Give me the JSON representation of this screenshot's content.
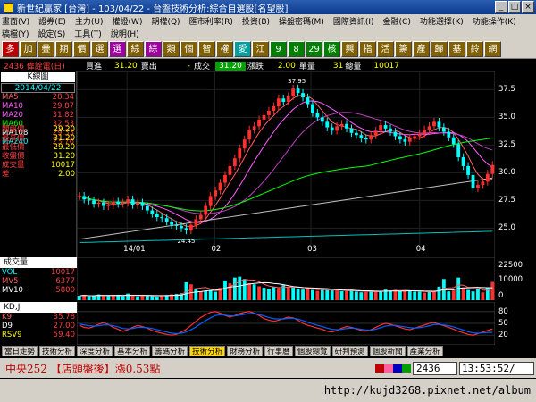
{
  "window": {
    "title": "新世紀贏家 [台灣] - 103/04/22 - 台盤技術分析:綜合自選股[名望股]",
    "buttons": [
      "_",
      "□",
      "×"
    ]
  },
  "menu": {
    "row1": [
      "畫面(V)",
      "證券(E)",
      "主力(U)",
      "權證(W)",
      "期權(Q)",
      "匯市利率(R)",
      "投資(B)",
      "操盤密碼(M)",
      "國際資訊(I)",
      "金融(C)",
      "功能選擇(K)",
      "功能操作(K)"
    ],
    "row2": [
      "稿檔(Y)",
      "設定(S)",
      "工具(T)",
      "說明(H)"
    ]
  },
  "toolbar": {
    "buttons": [
      {
        "label": "多",
        "color": "#c00000"
      },
      {
        "label": "加",
        "color": "#806000"
      },
      {
        "label": "疊",
        "color": "#806000"
      },
      {
        "label": "期",
        "color": "#806000"
      },
      {
        "label": "價",
        "color": "#806000"
      },
      {
        "label": "選",
        "color": "#806000"
      },
      {
        "label": "選",
        "color": "#a000a0"
      },
      {
        "label": "綜",
        "color": "#806000"
      },
      {
        "label": "綜",
        "color": "#a000a0"
      },
      {
        "label": "類",
        "color": "#806000"
      },
      {
        "label": "個",
        "color": "#806000"
      },
      {
        "label": "智",
        "color": "#806000"
      },
      {
        "label": "權",
        "color": "#806000"
      },
      {
        "label": "愛",
        "color": "#00a0a0"
      },
      {
        "label": "江",
        "color": "#806000"
      },
      {
        "label": "9",
        "color": "#008000"
      },
      {
        "label": "8",
        "color": "#008000"
      },
      {
        "label": "29",
        "color": "#008000"
      },
      {
        "label": "核",
        "color": "#008000"
      },
      {
        "label": "興",
        "color": "#806000"
      },
      {
        "label": "指",
        "color": "#806000"
      },
      {
        "label": "活",
        "color": "#806000"
      },
      {
        "label": "籌",
        "color": "#806000"
      },
      {
        "label": "產",
        "color": "#806000"
      },
      {
        "label": "歸",
        "color": "#806000"
      },
      {
        "label": "基",
        "color": "#806000"
      },
      {
        "label": "鈴",
        "color": "#806000"
      },
      {
        "label": "網",
        "color": "#806000"
      }
    ]
  },
  "quote": {
    "stock": "2436 偉詮電(日)",
    "buy_label": "買進",
    "buy_value": "31.20",
    "sell_label": "賣出",
    "sell_value": "-",
    "trade_label": "成交",
    "trade_value": "31.20",
    "change_label": "漲跌",
    "change_value": "2.00",
    "single_label": "單量",
    "single_value": "31",
    "total_label": "總量",
    "total_value": "10017"
  },
  "panel": {
    "header": "K線圖",
    "date": "2014/04/22",
    "ma": [
      {
        "label": "MA5",
        "value": "28.34",
        "color": "#ff6060"
      },
      {
        "label": "MA10",
        "value": "29.87",
        "color": "#ff60ff"
      },
      {
        "label": "MA20",
        "value": "31.82",
        "color": "#ff60ff"
      },
      {
        "label": "MA60",
        "value": "32.53",
        "color": "#00ff00"
      },
      {
        "label": "MA108",
        "value": "29.33",
        "color": "#ffffff"
      },
      {
        "label": "MA240",
        "value": "23.76",
        "color": "#00ffff"
      }
    ],
    "prices": [
      {
        "label": "開盤價",
        "value": "29.20"
      },
      {
        "label": "最高價",
        "value": "31.20"
      },
      {
        "label": "最低價",
        "value": "29.20"
      },
      {
        "label": "收盤價",
        "value": "31.20"
      },
      {
        "label": "成交量",
        "value": "10017"
      },
      {
        "label": "差",
        "value": "2.00"
      }
    ]
  },
  "volume": {
    "header": "成交量",
    "legend": [
      {
        "label": "VOL",
        "value": "10017",
        "color": "#00ffff"
      },
      {
        "label": "MV5",
        "value": "6377",
        "color": "#ff6060"
      },
      {
        "label": "MV10",
        "value": "5800",
        "color": "#ffffff"
      }
    ],
    "axis": [
      "22500",
      "10000",
      "0"
    ]
  },
  "kd": {
    "header": "KD,J",
    "legend": [
      {
        "label": "K9",
        "value": "35.78",
        "color": "#ff6060"
      },
      {
        "label": "D9",
        "value": "27.00",
        "color": "#ffffff"
      },
      {
        "label": "RSV9",
        "value": "59.40",
        "color": "#ffff00"
      }
    ],
    "axis": [
      "80",
      "50",
      "20"
    ]
  },
  "chart_data": [
    {
      "type": "candlestick",
      "title": "K線圖",
      "ylim": [
        23.5,
        38.5
      ],
      "y_ticks": [
        "37.5",
        "35.0",
        "32.5",
        "30.0",
        "27.5",
        "25.0"
      ],
      "x_ticks": [
        "14/01",
        "02",
        "03",
        "04"
      ],
      "annotations": [
        "37.95",
        "24.45"
      ],
      "close": [
        27.9,
        27.6,
        27.5,
        27.2,
        27.3,
        27.0,
        27.1,
        27.4,
        27.2,
        27.3,
        27.6,
        27.1,
        27.3,
        27.0,
        26.6,
        26.3,
        26.0,
        25.9,
        25.6,
        25.3,
        25.2,
        25.0,
        24.8,
        25.3,
        25.8,
        26.2,
        27.0,
        27.9,
        28.4,
        29.1,
        29.8,
        30.6,
        31.3,
        32.2,
        33.0,
        33.9,
        34.2,
        34.8,
        35.2,
        35.6,
        36.0,
        36.7,
        36.4,
        36.9,
        37.6,
        37.2,
        36.8,
        36.2,
        35.4,
        35.0,
        34.6,
        34.1,
        33.8,
        34.2,
        34.4,
        34.0,
        33.6,
        33.4,
        33.1,
        33.0,
        33.4,
        33.8,
        34.3,
        34.0,
        33.7,
        33.3,
        33.0,
        32.8,
        33.1,
        33.3,
        33.5,
        33.9,
        34.2,
        34.6,
        34.1,
        33.7,
        33.2,
        32.6,
        31.4,
        30.6,
        29.8,
        28.6,
        28.9,
        29.2,
        29.9,
        30.7
      ],
      "ma_lines": [
        {
          "name": "MA5",
          "color": "#ff6060"
        },
        {
          "name": "MA10",
          "color": "#ff60ff"
        },
        {
          "name": "MA20",
          "color": "#ff60ff"
        },
        {
          "name": "MA60",
          "color": "#00ff00"
        },
        {
          "name": "MA108",
          "color": "#ffffff"
        },
        {
          "name": "MA240",
          "color": "#00ffff"
        }
      ]
    },
    {
      "type": "bar",
      "title": "成交量",
      "ylim": [
        0,
        22500
      ],
      "values": [
        2400,
        2800,
        2100,
        2600,
        3100,
        2300,
        2700,
        2500,
        2900,
        2200,
        3600,
        2400,
        2100,
        2500,
        2700,
        2300,
        2000,
        2600,
        2800,
        3200,
        3400,
        3800,
        9800,
        8700,
        6200,
        4800,
        5200,
        5600,
        4600,
        6800,
        10800,
        9200,
        12400,
        12900,
        11600,
        9300,
        8700,
        7600,
        6800,
        6300,
        7100,
        6600,
        8200,
        7400,
        6900,
        6400,
        5800,
        6200,
        5600,
        5100,
        6000,
        5600,
        5400,
        5300,
        4900,
        5000,
        5700,
        4700,
        4300,
        4500,
        5100,
        4900,
        4600,
        5800,
        5200,
        5700,
        4900,
        5400,
        5000,
        4700,
        4600,
        4100,
        4400,
        5100,
        7400,
        11600,
        4800,
        5300,
        12400,
        7000,
        5600,
        4800,
        5900,
        4300,
        6900,
        10017
      ]
    },
    {
      "type": "line",
      "title": "KD,J",
      "ylim": [
        0,
        100
      ],
      "series": [
        {
          "name": "K9",
          "values": [
            45,
            40,
            38,
            42,
            48,
            52,
            47,
            40,
            35,
            30,
            34,
            40,
            45,
            42,
            38,
            32,
            28,
            25,
            22,
            20,
            22,
            28,
            35,
            45,
            55,
            65,
            72,
            78,
            80,
            76,
            70,
            66,
            70,
            75,
            78,
            80,
            76,
            70,
            62,
            58,
            55,
            58,
            62,
            66,
            64,
            58,
            50,
            45,
            42,
            38,
            35,
            30,
            28,
            32,
            38,
            42,
            40,
            36,
            32,
            30,
            34,
            40,
            46,
            50,
            48,
            44,
            40,
            36,
            34,
            38,
            42,
            46,
            50,
            52,
            48,
            44,
            40,
            35,
            30,
            26,
            22,
            20,
            24,
            28,
            32,
            35.78
          ]
        },
        {
          "name": "D9",
          "values": [
            48,
            46,
            44,
            43,
            44,
            46,
            46,
            44,
            41,
            37,
            36,
            37,
            40,
            40,
            39,
            37,
            34,
            31,
            28,
            25,
            24,
            25,
            28,
            34,
            41,
            49,
            57,
            64,
            70,
            72,
            71,
            69,
            69,
            71,
            73,
            75,
            75,
            73,
            69,
            65,
            62,
            61,
            61,
            63,
            63,
            61,
            57,
            53,
            49,
            45,
            42,
            38,
            35,
            34,
            35,
            37,
            38,
            37,
            35,
            33,
            33,
            35,
            39,
            43,
            45,
            45,
            43,
            41,
            39,
            38,
            39,
            41,
            44,
            47,
            47,
            46,
            44,
            41,
            37,
            33,
            29,
            26,
            25,
            26,
            27,
            27.0
          ]
        }
      ]
    }
  ],
  "tabs": [
    "當日走勢",
    "技術分析",
    "深度分析",
    "基本分析",
    "籌碼分析",
    "技術分析",
    "財務分析",
    "行事曆",
    "個股總覽",
    "研判預測",
    "個股新聞",
    "產業分析"
  ],
  "active_tab": 5,
  "status": {
    "news": "中央252 【店頭盤後】漲0.53點",
    "code": "2436",
    "clock": "13:53:52/"
  },
  "watermark": "http://kujd3268.pixnet.net/album",
  "colors": {
    "up": "#ff3030",
    "down": "#00ffff",
    "bg": "#000000"
  }
}
